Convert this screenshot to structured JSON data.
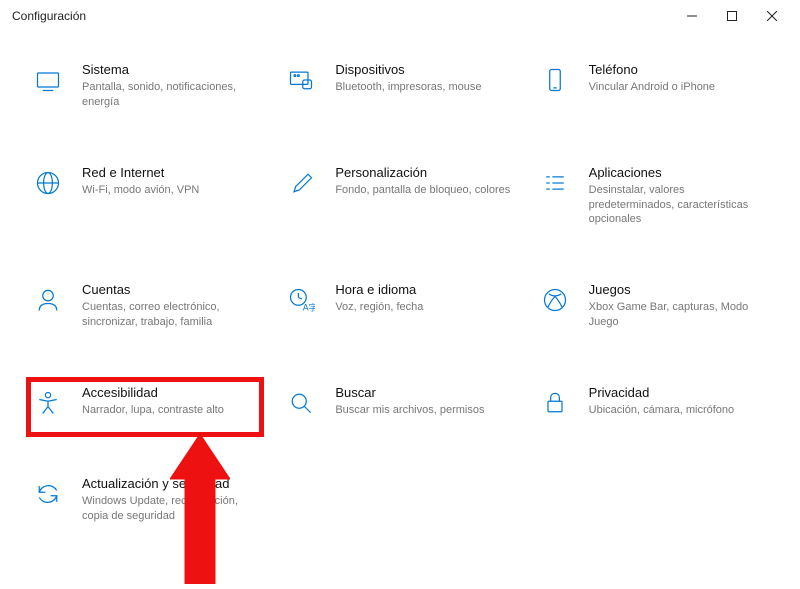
{
  "window": {
    "title": "Configuración"
  },
  "tiles": {
    "sistema": {
      "title": "Sistema",
      "desc": "Pantalla, sonido, notificaciones, energía"
    },
    "dispositivos": {
      "title": "Dispositivos",
      "desc": "Bluetooth, impresoras, mouse"
    },
    "telefono": {
      "title": "Teléfono",
      "desc": "Vincular Android o iPhone"
    },
    "red": {
      "title": "Red e Internet",
      "desc": "Wi-Fi, modo avión, VPN"
    },
    "personalizacion": {
      "title": "Personalización",
      "desc": "Fondo, pantalla de bloqueo, colores"
    },
    "aplicaciones": {
      "title": "Aplicaciones",
      "desc": "Desinstalar, valores predeterminados, características opcionales"
    },
    "cuentas": {
      "title": "Cuentas",
      "desc": "Cuentas, correo electrónico, sincronizar, trabajo, familia"
    },
    "hora": {
      "title": "Hora e idioma",
      "desc": "Voz, región, fecha"
    },
    "juegos": {
      "title": "Juegos",
      "desc": "Xbox Game Bar, capturas, Modo Juego"
    },
    "accesibilidad": {
      "title": "Accesibilidad",
      "desc": "Narrador, lupa, contraste alto"
    },
    "buscar": {
      "title": "Buscar",
      "desc": "Buscar mis archivos, permisos"
    },
    "privacidad": {
      "title": "Privacidad",
      "desc": "Ubicación, cámara, micrófono"
    },
    "actualizacion": {
      "title": "Actualización y seguridad",
      "desc": "Windows Update, recuperación, copia de seguridad"
    }
  }
}
